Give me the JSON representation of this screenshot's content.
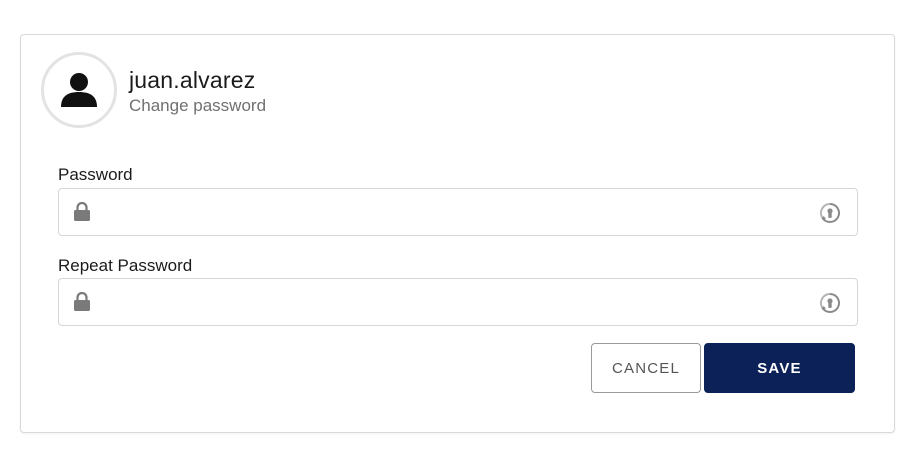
{
  "profile": {
    "username": "juan.alvarez",
    "subtitle": "Change password"
  },
  "form": {
    "password": {
      "label": "Password",
      "value": "",
      "placeholder": ""
    },
    "repeat_password": {
      "label": "Repeat Password",
      "value": "",
      "placeholder": ""
    }
  },
  "actions": {
    "cancel_label": "CANCEL",
    "save_label": "SAVE"
  },
  "icons": {
    "avatar": "user-icon",
    "field_leading": "lock-icon",
    "field_trailing": "password-reveal-icon"
  },
  "colors": {
    "primary": "#0c2157",
    "border": "#d6d6d6",
    "muted_text": "#707070"
  }
}
